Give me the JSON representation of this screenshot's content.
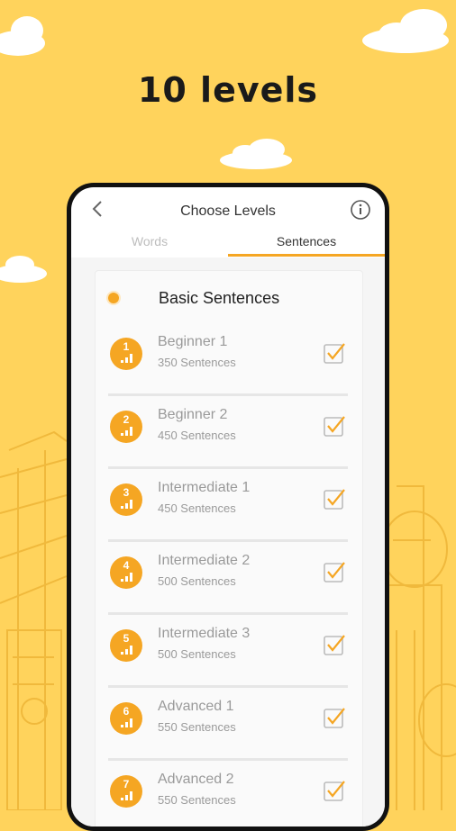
{
  "headline": "10 levels",
  "app": {
    "title": "Choose Levels",
    "tabs": [
      {
        "label": "Words",
        "active": false
      },
      {
        "label": "Sentences",
        "active": true
      }
    ]
  },
  "section": {
    "title": "Basic Sentences"
  },
  "levels": [
    {
      "num": "1",
      "name": "Beginner 1",
      "count": "350 Sentences",
      "checked": true
    },
    {
      "num": "2",
      "name": "Beginner 2",
      "count": "450 Sentences",
      "checked": true
    },
    {
      "num": "3",
      "name": "Intermediate 1",
      "count": "450 Sentences",
      "checked": true
    },
    {
      "num": "4",
      "name": "Intermediate 2",
      "count": "500 Sentences",
      "checked": true
    },
    {
      "num": "5",
      "name": "Intermediate 3",
      "count": "500 Sentences",
      "checked": true
    },
    {
      "num": "6",
      "name": "Advanced 1",
      "count": "550 Sentences",
      "checked": true
    },
    {
      "num": "7",
      "name": "Advanced 2",
      "count": "550 Sentences",
      "checked": true
    }
  ],
  "colors": {
    "background": "#FFD35C",
    "accent": "#F5A623",
    "muted_text": "#9a9a9a"
  },
  "icons": {
    "back": "chevron-left-icon",
    "info": "info-icon",
    "check": "checkbox-checked-icon",
    "level_bars": "signal-bars-icon"
  }
}
